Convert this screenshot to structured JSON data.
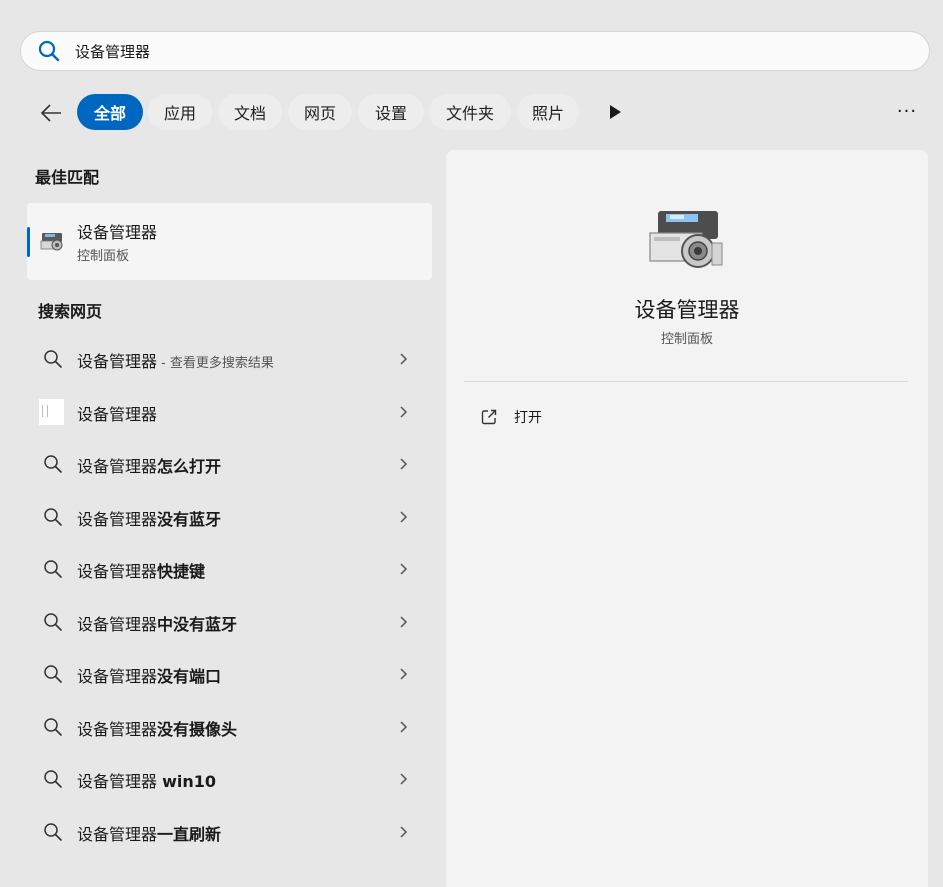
{
  "search": {
    "query": "设备管理器"
  },
  "filters": {
    "back_label": "",
    "chips": [
      "全部",
      "应用",
      "文档",
      "网页",
      "设置",
      "文件夹",
      "照片"
    ],
    "active": "全部",
    "more_label": "···"
  },
  "best_match": {
    "heading": "最佳匹配",
    "title": "设备管理器",
    "subtitle": "控制面板",
    "icon": "device-manager-icon"
  },
  "web": {
    "heading": "搜索网页",
    "items": [
      {
        "prefix": "设备管理器",
        "bold": "",
        "note": "- 查看更多搜索结果",
        "icon": "search-icon"
      },
      {
        "prefix": "设备管理器",
        "bold": "",
        "note": "",
        "icon": "web-thumbnail"
      },
      {
        "prefix": "设备管理器",
        "bold": "怎么打开",
        "note": "",
        "icon": "search-icon"
      },
      {
        "prefix": "设备管理器",
        "bold": "没有蓝牙",
        "note": "",
        "icon": "search-icon"
      },
      {
        "prefix": "设备管理器",
        "bold": "快捷键",
        "note": "",
        "icon": "search-icon"
      },
      {
        "prefix": "设备管理器",
        "bold": "中没有蓝牙",
        "note": "",
        "icon": "search-icon"
      },
      {
        "prefix": "设备管理器",
        "bold": "没有端口",
        "note": "",
        "icon": "search-icon"
      },
      {
        "prefix": "设备管理器",
        "bold": "没有摄像头",
        "note": "",
        "icon": "search-icon"
      },
      {
        "prefix": "设备管理器 ",
        "bold": "win10",
        "note": "",
        "icon": "search-icon"
      },
      {
        "prefix": "设备管理器",
        "bold": "一直刷新",
        "note": "",
        "icon": "search-icon"
      }
    ]
  },
  "detail": {
    "title": "设备管理器",
    "subtitle": "控制面板",
    "actions": [
      {
        "label": "打开",
        "icon": "open-external-icon"
      }
    ]
  },
  "colors": {
    "accent": "#0067c0",
    "background": "#e7e7e7",
    "panel": "#f3f3f3"
  }
}
